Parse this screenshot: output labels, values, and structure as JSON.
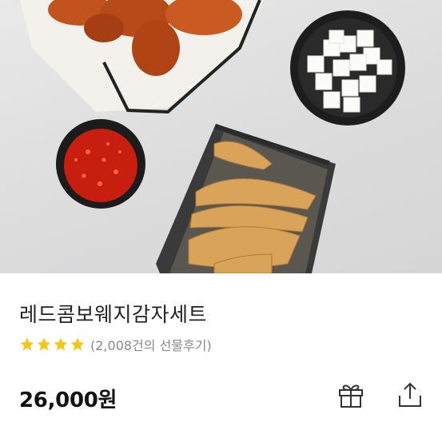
{
  "product": {
    "image_alt": "레드콤보웨지감자세트 product photo",
    "title": "레드콤보웨지감자세트",
    "rating": 4,
    "rating_max": 4,
    "review_text": "(2,008건의 선물후기)",
    "price": "26,000원"
  },
  "actions": {
    "gift_icon": "gift-icon",
    "share_icon": "share-icon"
  },
  "colors": {
    "star": "#f5c518",
    "price": "#111111",
    "title": "#222222",
    "review": "#8a8a8a"
  }
}
